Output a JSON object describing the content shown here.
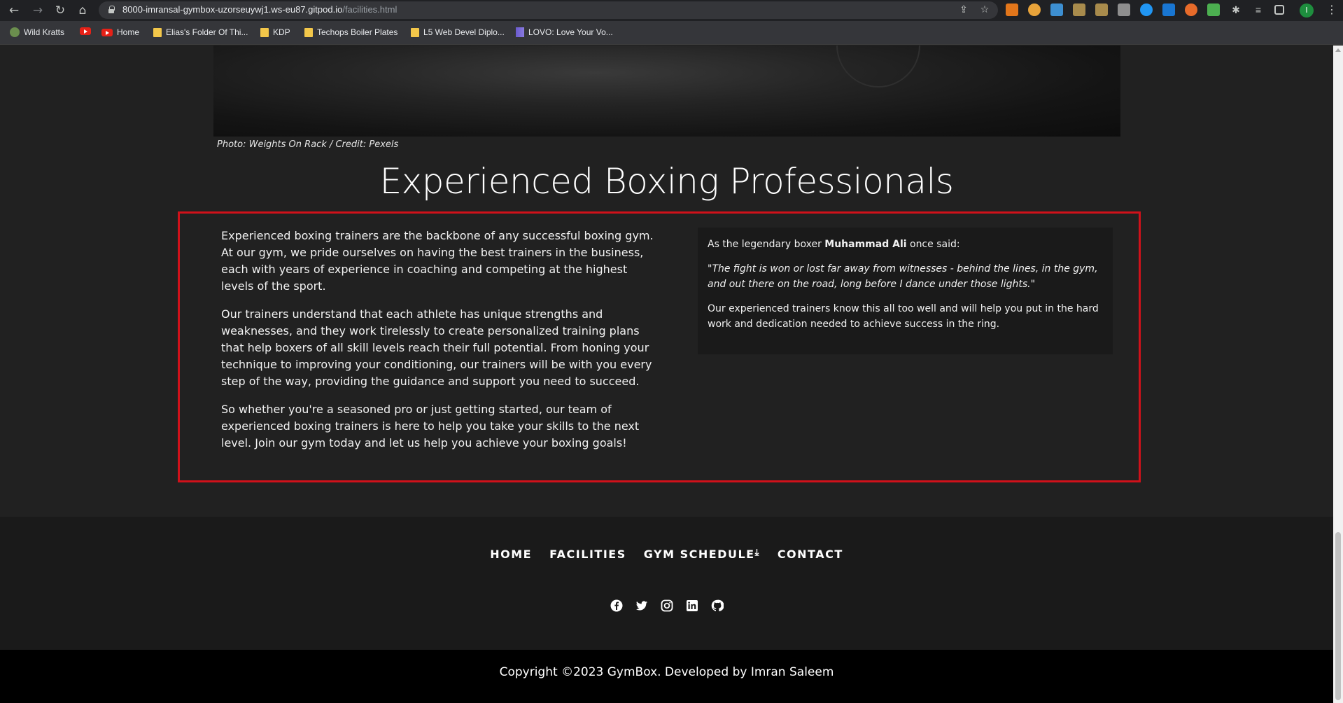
{
  "browser": {
    "url_host": "8000-imransal-gymbox-uzorseuywj1.ws-eu87.gitpod.io",
    "url_path": "/facilities.html",
    "profile_initial": "I",
    "bookmarks": [
      {
        "label": "Wild Kratts",
        "icon": "wild-kratts-icon"
      },
      {
        "label": "",
        "icon": "youtube-icon"
      },
      {
        "label": "Home",
        "icon": "youtube-icon"
      },
      {
        "label": "Elias's Folder Of Thi...",
        "icon": "folder-icon"
      },
      {
        "label": "KDP",
        "icon": "folder-icon"
      },
      {
        "label": "Techops Boiler Plates",
        "icon": "folder-icon"
      },
      {
        "label": "L5 Web Devel Diplo...",
        "icon": "folder-icon"
      },
      {
        "label": "LOVO: Love Your Vo...",
        "icon": "lovo-icon"
      }
    ]
  },
  "page": {
    "caption": "Photo: Weights On Rack / Credit: Pexels",
    "section_title": "Experienced Boxing Professionals",
    "paragraphs": [
      "Experienced boxing trainers are the backbone of any successful boxing gym. At our gym, we pride ourselves on having the best trainers in the business, each with years of experience in coaching and competing at the highest levels of the sport.",
      "Our trainers understand that each athlete has unique strengths and weaknesses, and they work tirelessly to create personalized training plans that help boxers of all skill levels reach their full potential. From honing your technique to improving your conditioning, our trainers will be with you every step of the way, providing the guidance and support you need to succeed.",
      "So whether you're a seasoned pro or just getting started, our team of experienced boxing trainers is here to help you take your skills to the next level. Join our gym today and let us help you achieve your boxing goals!"
    ],
    "quote_card": {
      "intro_before": "As the legendary boxer ",
      "boxer": "Muhammad Ali",
      "intro_after": " once said:",
      "quote": "\"The fight is won or lost far away from witnesses - behind the lines, in the gym, and out there on the road, long before I dance under those lights.\"",
      "closing": "Our experienced trainers know this all too well and will help you put in the hard work and dedication needed to achieve success in the ring."
    }
  },
  "footer": {
    "nav": [
      "HOME",
      "FACILITIES",
      "GYM SCHEDULE",
      "CONTACT"
    ],
    "schedule_icon": "download-icon",
    "social": [
      "facebook-icon",
      "twitter-icon",
      "instagram-icon",
      "linkedin-icon",
      "github-icon"
    ],
    "copyright": "Copyright ©2023 GymBox. Developed by Imran Saleem"
  },
  "colors": {
    "page_bg": "#212121",
    "footer_bg": "#1a1a1a",
    "outline": "#d0111a"
  }
}
